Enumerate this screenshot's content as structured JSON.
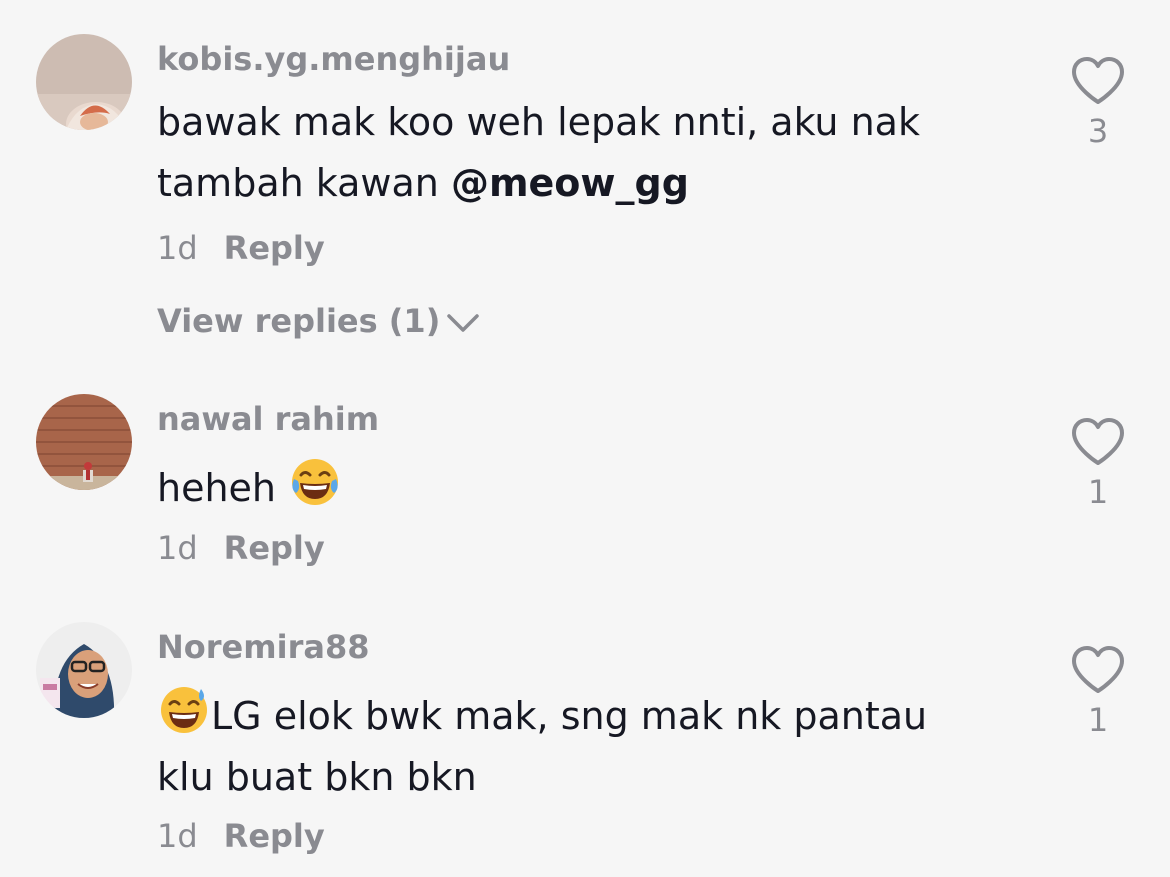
{
  "comments": [
    {
      "username": "kobis.yg.menghijau",
      "text_line1": "bawak mak koo weh lepak nnti, aku nak",
      "text_line2_prefix": "tambah kawan ",
      "mention": "@meow_gg",
      "time": "1d",
      "reply_label": "Reply",
      "view_replies": "View replies (1)",
      "likes": "3",
      "avatar_icon": "person-avatar"
    },
    {
      "username": "nawal rahim",
      "text": "heheh",
      "emoji": "face-with-tears-of-joy",
      "time": "1d",
      "reply_label": "Reply",
      "likes": "1",
      "avatar_icon": "brick-wall-avatar"
    },
    {
      "username": "Noremira88",
      "emoji": "grinning-face-with-sweat",
      "text_line1": "LG elok bwk mak, sng mak nk pantau",
      "text_line2": "klu buat bkn bkn",
      "time": "1d",
      "reply_label": "Reply",
      "likes": "1",
      "avatar_icon": "hijab-woman-avatar"
    }
  ],
  "colors": {
    "background": "#f6f6f6",
    "text": "#161823",
    "muted": "#8a8b91"
  }
}
